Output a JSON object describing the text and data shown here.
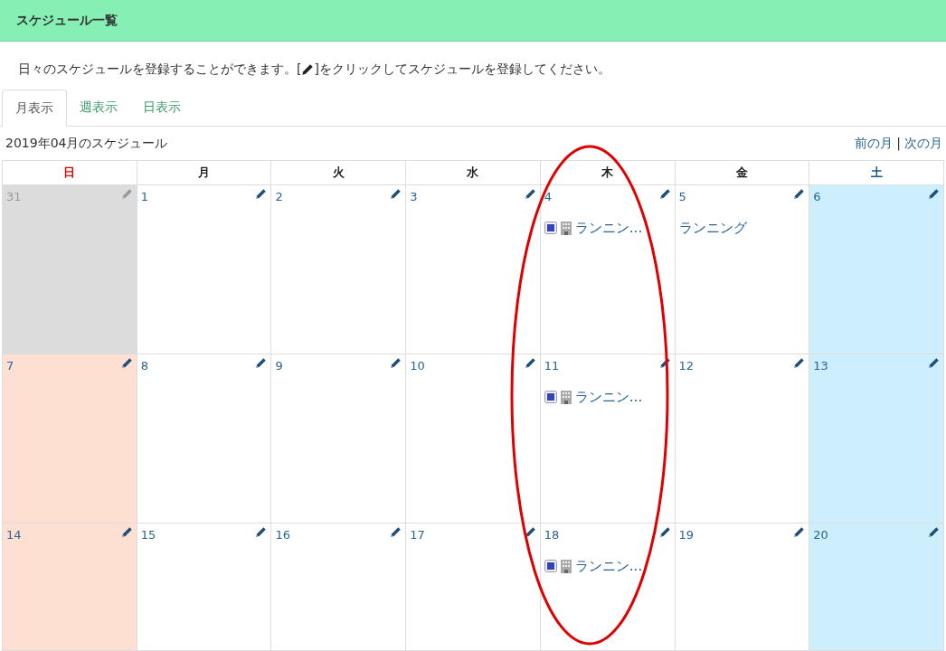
{
  "panel": {
    "title": "スケジュール一覧"
  },
  "description": {
    "before": "日々のスケジュールを登録することができます。[",
    "after": "]をクリックしてスケジュールを登録してください。"
  },
  "tabs": [
    {
      "label": "月表示",
      "selected": true
    },
    {
      "label": "週表示",
      "selected": false
    },
    {
      "label": "日表示",
      "selected": false
    }
  ],
  "calendar": {
    "title": "2019年04月のスケジュール",
    "prev": "前の月",
    "separator": "|",
    "next": "次の月",
    "weekdays": [
      {
        "label": "日",
        "kind": "sunday",
        "circled": false
      },
      {
        "label": "月",
        "kind": "normal",
        "circled": false
      },
      {
        "label": "火",
        "kind": "normal",
        "circled": false
      },
      {
        "label": "水",
        "kind": "normal",
        "circled": false
      },
      {
        "label": "木",
        "kind": "normal",
        "circled": true
      },
      {
        "label": "金",
        "kind": "normal",
        "circled": false
      },
      {
        "label": "土",
        "kind": "saturday",
        "circled": false
      }
    ],
    "weeks": [
      [
        {
          "day": "31",
          "kind": "other_month"
        },
        {
          "day": "1",
          "kind": "normal"
        },
        {
          "day": "2",
          "kind": "normal"
        },
        {
          "day": "3",
          "kind": "normal"
        },
        {
          "day": "4",
          "kind": "normal",
          "events": [
            {
              "text": "ランニン...",
              "weekly": true,
              "facility": true
            }
          ]
        },
        {
          "day": "5",
          "kind": "normal",
          "events": [
            {
              "text": "ランニング",
              "weekly": false,
              "facility": false
            }
          ]
        },
        {
          "day": "6",
          "kind": "saturday"
        }
      ],
      [
        {
          "day": "7",
          "kind": "sunday"
        },
        {
          "day": "8",
          "kind": "normal"
        },
        {
          "day": "9",
          "kind": "normal"
        },
        {
          "day": "10",
          "kind": "normal"
        },
        {
          "day": "11",
          "kind": "normal",
          "events": [
            {
              "text": "ランニン...",
              "weekly": true,
              "facility": true
            }
          ]
        },
        {
          "day": "12",
          "kind": "normal"
        },
        {
          "day": "13",
          "kind": "saturday"
        }
      ],
      [
        {
          "day": "14",
          "kind": "sunday"
        },
        {
          "day": "15",
          "kind": "normal"
        },
        {
          "day": "16",
          "kind": "normal"
        },
        {
          "day": "17",
          "kind": "normal"
        },
        {
          "day": "18",
          "kind": "normal",
          "events": [
            {
              "text": "ランニン...",
              "weekly": true,
              "facility": true
            }
          ]
        },
        {
          "day": "19",
          "kind": "normal"
        },
        {
          "day": "20",
          "kind": "saturday"
        }
      ]
    ]
  }
}
